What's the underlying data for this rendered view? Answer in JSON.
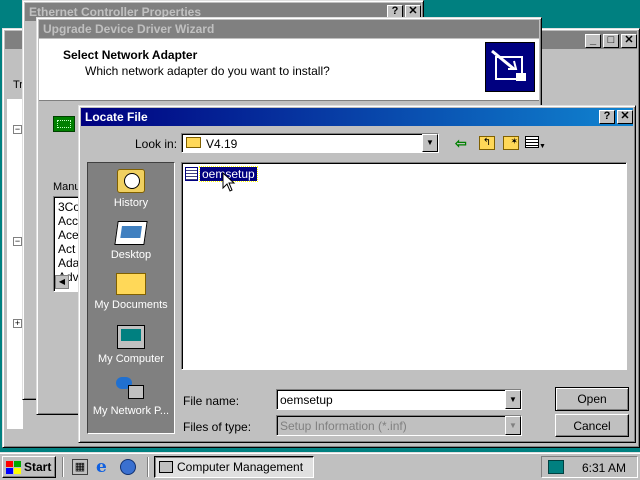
{
  "windows": {
    "ethernet": {
      "title": "Ethernet Controller Properties"
    },
    "mmc": {
      "title_fragment": "Tr"
    },
    "wizard": {
      "title": "Upgrade Device Driver Wizard",
      "heading": "Select Network Adapter",
      "subheading": "Which network adapter do you want to install?",
      "manufacturers_label": "Manu",
      "manufacturers": [
        "3Co",
        "Acc",
        "Ace",
        "Act",
        "Ada",
        "Adv"
      ]
    },
    "locate": {
      "title": "Locate File",
      "look_in_label": "Look in:",
      "look_in_value": "V4.19",
      "places": [
        {
          "label": "History",
          "icon": "history-icon"
        },
        {
          "label": "Desktop",
          "icon": "desktop-icon"
        },
        {
          "label": "My Documents",
          "icon": "my-documents-icon"
        },
        {
          "label": "My Computer",
          "icon": "my-computer-icon"
        },
        {
          "label": "My Network P...",
          "icon": "my-network-places-icon"
        }
      ],
      "files": [
        {
          "name": "oemsetup",
          "icon": "setup-information-icon",
          "selected": true
        }
      ],
      "file_name_label": "File name:",
      "file_name_value": "oemsetup",
      "files_of_type_label": "Files of type:",
      "files_of_type_value": "Setup Information (*.inf)",
      "open_label": "Open",
      "cancel_label": "Cancel"
    }
  },
  "taskbar": {
    "start_label": "Start",
    "task_label": "Computer Management",
    "clock": "6:31 AM"
  },
  "colors": {
    "desktop": "#008080",
    "active_title": "#000080",
    "selection": "#000080"
  }
}
